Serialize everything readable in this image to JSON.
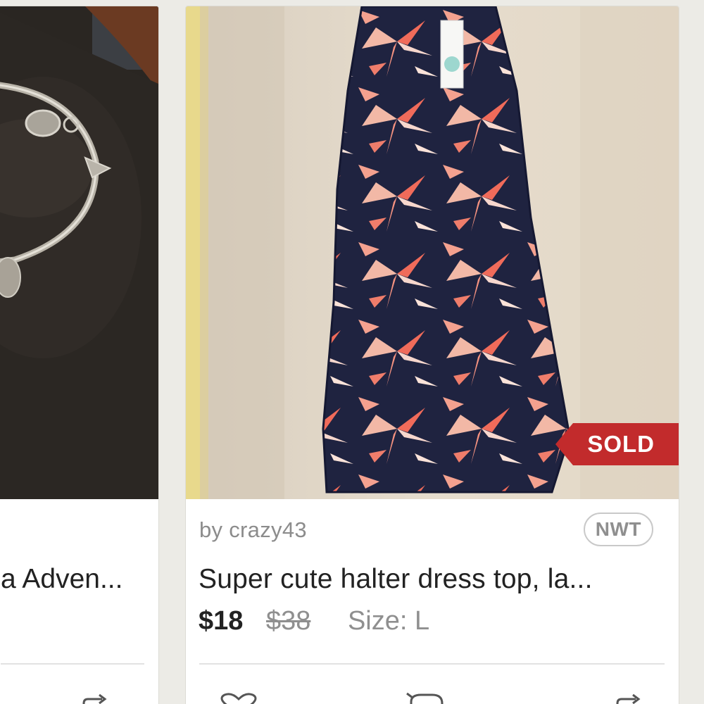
{
  "left_listing": {
    "title": "a Adven..."
  },
  "right_listing": {
    "seller": "by crazy43",
    "condition_badge": "NWT",
    "title": "Super cute halter dress top, la...",
    "price": "$18",
    "original_price": "$38",
    "size": "Size: L",
    "status_ribbon": "SOLD"
  },
  "icons": {
    "like": "heart-icon",
    "comment": "comment-icon",
    "share": "share-icon"
  },
  "colors": {
    "background": "#ecebe6",
    "sold_ribbon": "#c22b2c",
    "text_primary": "#222222",
    "text_secondary": "#8c8c8c"
  }
}
